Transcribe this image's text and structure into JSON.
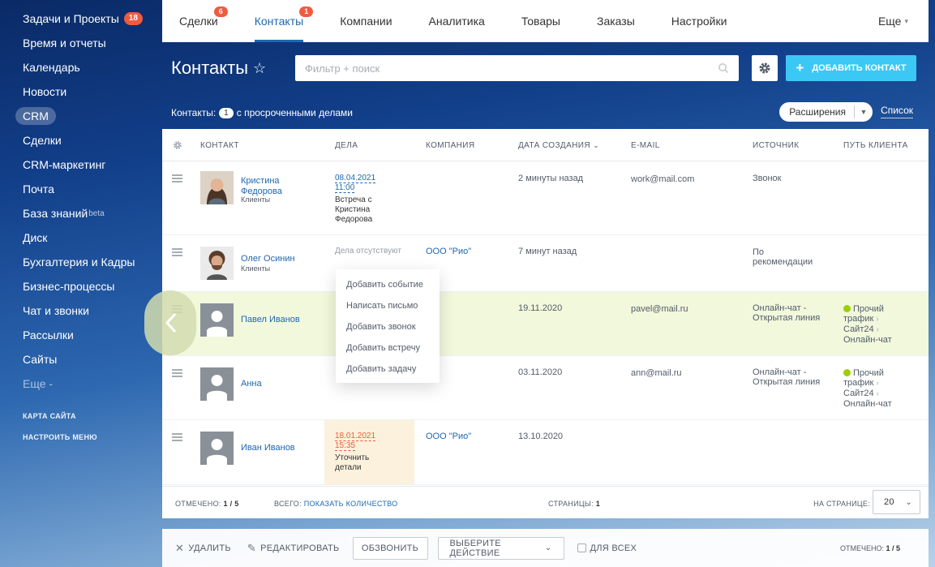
{
  "sidebar": {
    "items": [
      {
        "label": "Задачи и Проекты",
        "badge": "18"
      },
      {
        "label": "Время и отчеты"
      },
      {
        "label": "Календарь"
      },
      {
        "label": "Новости"
      },
      {
        "label": "CRM"
      },
      {
        "label": "Сделки"
      },
      {
        "label": "CRM-маркетинг"
      },
      {
        "label": "Почта"
      },
      {
        "label": "База знаний",
        "sup": "beta"
      },
      {
        "label": "Диск"
      },
      {
        "label": "Бухгалтерия и Кадры"
      },
      {
        "label": "Бизнес-процессы"
      },
      {
        "label": "Чат и звонки"
      },
      {
        "label": "Рассылки"
      },
      {
        "label": "Сайты"
      },
      {
        "label": "Еще -"
      }
    ],
    "sitemap": "КАРТА САЙТА",
    "configure": "НАСТРОИТЬ МЕНЮ"
  },
  "tabs": [
    {
      "label": "Сделки",
      "badge": "6"
    },
    {
      "label": "Контакты",
      "badge": "1"
    },
    {
      "label": "Компании"
    },
    {
      "label": "Аналитика"
    },
    {
      "label": "Товары"
    },
    {
      "label": "Заказы"
    },
    {
      "label": "Настройки"
    },
    {
      "label": "Еще"
    }
  ],
  "header": {
    "title": "Контакты",
    "search_placeholder": "Фильтр + поиск",
    "add_button": "ДОБАВИТЬ КОНТАКТ"
  },
  "subbar": {
    "prefix": "Контакты:",
    "count": "1",
    "suffix": "с просроченными делами",
    "extensions": "Расширения",
    "list": "Список"
  },
  "columns": [
    "КОНТАКТ",
    "ДЕЛА",
    "КОМПАНИЯ",
    "ДАТА СОЗДАНИЯ",
    "E-MAIL",
    "ИСТОЧНИК",
    "ПУТЬ КЛИЕНТА"
  ],
  "rows": [
    {
      "name1": "Кристина",
      "name2": "Федорова",
      "type": "Клиенты",
      "deal_date": "08.04.2021",
      "deal_time": "11:00",
      "deal_text": [
        "Встреча с",
        "Кристина",
        "Федорова"
      ],
      "created": "2 минуты назад",
      "email": "work@mail.com",
      "source": [
        "Звонок"
      ]
    },
    {
      "name1": "Олег Осинин",
      "type": "Клиенты",
      "deal_none": "Дела отсутствуют",
      "company": "ООО \"Рио\"",
      "created": "7 минут назад",
      "source": [
        "По",
        "рекомендации"
      ]
    },
    {
      "name1": "Павел Иванов",
      "created": "19.11.2020",
      "email": "pavel@mail.ru",
      "source": [
        "Онлайн-чат -",
        "Открытая линия"
      ],
      "journey": [
        "Прочий",
        "трафик",
        "Сайт24",
        "Онлайн-чат"
      ]
    },
    {
      "name1": "Анна",
      "created": "03.11.2020",
      "email": "ann@mail.ru",
      "source": [
        "Онлайн-чат -",
        "Открытая линия"
      ],
      "journey": [
        "Прочий",
        "трафик",
        "Сайт24",
        "Онлайн-чат"
      ]
    },
    {
      "name1": "Иван Иванов",
      "deal_date": "18.01.2021",
      "deal_time": "15:35",
      "deal_text": [
        "Уточнить",
        "детали"
      ],
      "company": "ООО \"Рио\"",
      "created": "13.10.2020"
    }
  ],
  "menu": [
    "Добавить событие",
    "Написать письмо",
    "Добавить звонок",
    "Добавить встречу",
    "Добавить задачу"
  ],
  "footer": {
    "selected_label": "ОТМЕЧЕНО:",
    "selected_value": "1 / 5",
    "total_label": "ВСЕГО:",
    "total_link": "ПОКАЗАТЬ КОЛИЧЕСТВО",
    "pages_label": "СТРАНИЦЫ:",
    "pages_value": "1",
    "per_page_label": "НА СТРАНИЦЕ:",
    "per_page_value": "20"
  },
  "actions": {
    "delete": "УДАЛИТЬ",
    "edit": "РЕДАКТИРОВАТЬ",
    "call": "ОБЗВОНИТЬ",
    "choose": "ВЫБЕРИТЕ ДЕЙСТВИЕ",
    "for_all": "ДЛЯ ВСЕХ",
    "selected_label": "ОТМЕЧЕНО:",
    "selected_value": "1 / 5"
  },
  "colors": {
    "accent": "#2067b0",
    "badge": "#f05b3f",
    "add_button": "#3bc8f5",
    "highlight_row": "#f1f8dc",
    "journey_dot": "#9dcf00"
  }
}
